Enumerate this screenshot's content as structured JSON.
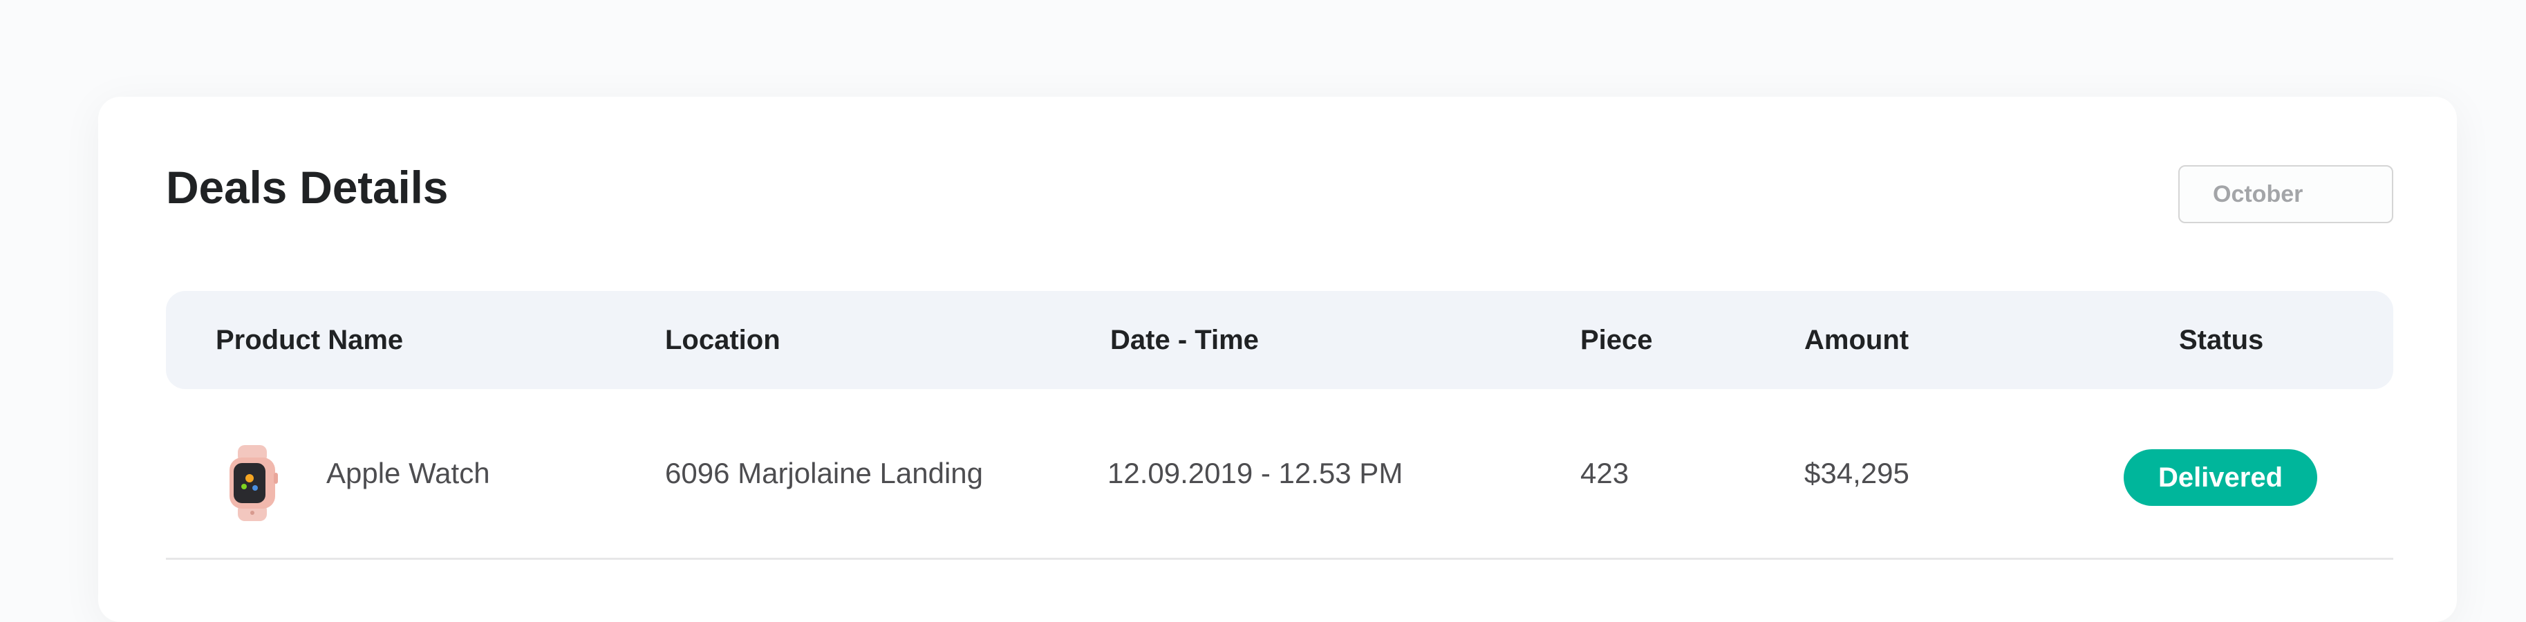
{
  "card": {
    "title": "Deals Details",
    "month_select": {
      "value": "October"
    }
  },
  "table": {
    "columns": [
      "Product Name",
      "Location",
      "Date - Time",
      "Piece",
      "Amount",
      "Status"
    ],
    "rows": [
      {
        "product_icon": "apple-watch-icon",
        "product": "Apple Watch",
        "location": "6096 Marjolaine Landing",
        "datetime": "12.09.2019 - 12.53 PM",
        "piece": "423",
        "amount": "$34,295",
        "status": "Delivered"
      }
    ]
  },
  "colors": {
    "accent_status": "#00b69b",
    "header_bg": "#f1f4f9",
    "card_bg": "#ffffff"
  }
}
